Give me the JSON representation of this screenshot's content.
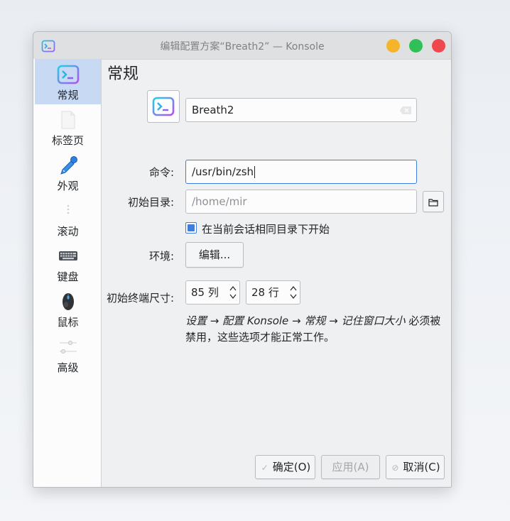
{
  "window": {
    "title": "编辑配置方案“Breath2” — Konsole"
  },
  "sidebar": {
    "items": [
      {
        "label": "常规",
        "icon": "konsole-icon",
        "active": true
      },
      {
        "label": "标签页",
        "icon": "tab-page-icon"
      },
      {
        "label": "外观",
        "icon": "color-picker-icon"
      },
      {
        "label": "滚动",
        "icon": "scroll-icon"
      },
      {
        "label": "键盘",
        "icon": "keyboard-icon"
      },
      {
        "label": "鼠标",
        "icon": "mouse-icon"
      },
      {
        "label": "高级",
        "icon": "advanced-sliders-icon"
      }
    ]
  },
  "main": {
    "page_title": "常规",
    "profile_name": "Breath2",
    "command_label": "命令:",
    "command_value": "/usr/bin/zsh",
    "initial_dir_label": "初始目录:",
    "initial_dir_placeholder": "/home/mir",
    "same_dir_checkbox_label": "在当前会话相同目录下开始",
    "same_dir_checked": true,
    "env_label": "环境:",
    "env_edit_button": "编辑...",
    "terminal_size_label": "初始终端尺寸:",
    "columns_value": "85 列",
    "rows_value": "28 行",
    "note_line1_parts": [
      "设置",
      " → ",
      "配置 Konsole",
      " → ",
      "常规",
      " → ",
      "记住窗口大小",
      " 必须被"
    ],
    "note_line2": "禁用，这些选项才能正常工作。"
  },
  "footer": {
    "ok_button": "确定(O)",
    "apply_button": "应用(A)",
    "cancel_button": "取消(C)"
  },
  "colors": {
    "accent": "#3d7ee0",
    "active_nav_bg": "#c8d9f3",
    "minimize": "#f6b42a",
    "maximize": "#2fc157",
    "close": "#f0474f"
  }
}
